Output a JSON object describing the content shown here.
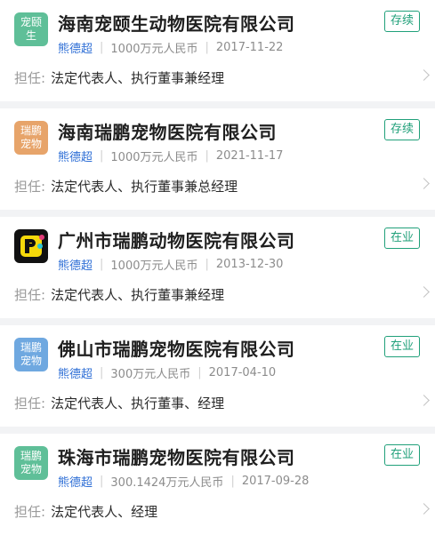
{
  "duty_label": "担任:",
  "companies": [
    {
      "logo_line1": "宠颐",
      "logo_line2": "生",
      "logo_color": "#5fbf98",
      "name": "海南宠颐生动物医院有限公司",
      "status": "存续",
      "representative": "熊德超",
      "capital": "1000万元人民币",
      "date": "2017-11-22",
      "duty": "法定代表人、执行董事兼经理"
    },
    {
      "logo_line1": "瑞鹏",
      "logo_line2": "宠物",
      "logo_color": "#e7a46a",
      "name": "海南瑞鹏宠物医院有限公司",
      "status": "存续",
      "representative": "熊德超",
      "capital": "1000万元人民币",
      "date": "2021-11-17",
      "duty": "法定代表人、执行董事兼总经理"
    },
    {
      "logo_image": "p-plus-logo",
      "name": "广州市瑞鹏动物医院有限公司",
      "status": "在业",
      "representative": "熊德超",
      "capital": "1000万元人民币",
      "date": "2013-12-30",
      "duty": "法定代表人、执行董事兼经理"
    },
    {
      "logo_line1": "瑞鹏",
      "logo_line2": "宠物",
      "logo_color": "#6fa8e0",
      "name": "佛山市瑞鹏宠物医院有限公司",
      "status": "在业",
      "representative": "熊德超",
      "capital": "300万元人民币",
      "date": "2017-04-10",
      "duty": "法定代表人、执行董事、经理"
    },
    {
      "logo_line1": "瑞鹏",
      "logo_line2": "宠物",
      "logo_color": "#5fbf98",
      "name": "珠海市瑞鹏宠物医院有限公司",
      "status": "在业",
      "representative": "熊德超",
      "capital": "300.1424万元人民币",
      "date": "2017-09-28",
      "duty": "法定代表人、经理"
    }
  ]
}
